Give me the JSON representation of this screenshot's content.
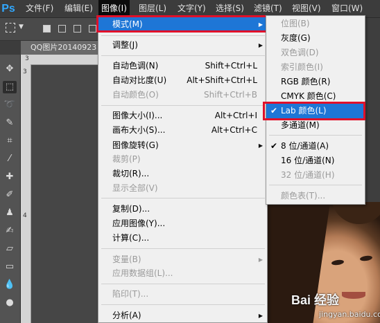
{
  "app": {
    "logo": "Ps"
  },
  "menubar": {
    "items": [
      {
        "label": "文件(F)"
      },
      {
        "label": "编辑(E)"
      },
      {
        "label": "图像(I)"
      },
      {
        "label": "图层(L)"
      },
      {
        "label": "文字(Y)"
      },
      {
        "label": "选择(S)"
      },
      {
        "label": "滤镜(T)"
      },
      {
        "label": "视图(V)"
      },
      {
        "label": "窗口(W)"
      }
    ]
  },
  "document": {
    "tab_title": "QQ图片20140923"
  },
  "rulers": {
    "top_first": "3",
    "left": [
      "3",
      "4"
    ]
  },
  "image_menu": {
    "items": [
      {
        "label": "模式(M)",
        "shortcut": "",
        "submenu": true,
        "disabled": false,
        "highlighted": true
      },
      {
        "label": "调整(J)",
        "shortcut": "",
        "submenu": true,
        "disabled": false
      },
      {
        "label": "自动色调(N)",
        "shortcut": "Shift+Ctrl+L",
        "disabled": false
      },
      {
        "label": "自动对比度(U)",
        "shortcut": "Alt+Shift+Ctrl+L",
        "disabled": false
      },
      {
        "label": "自动颜色(O)",
        "shortcut": "Shift+Ctrl+B",
        "disabled": true
      },
      {
        "label": "图像大小(I)...",
        "shortcut": "Alt+Ctrl+I",
        "disabled": false
      },
      {
        "label": "画布大小(S)...",
        "shortcut": "Alt+Ctrl+C",
        "disabled": false
      },
      {
        "label": "图像旋转(G)",
        "shortcut": "",
        "submenu": true,
        "disabled": false
      },
      {
        "label": "裁剪(P)",
        "shortcut": "",
        "disabled": true
      },
      {
        "label": "裁切(R)...",
        "shortcut": "",
        "disabled": false
      },
      {
        "label": "显示全部(V)",
        "shortcut": "",
        "disabled": true
      },
      {
        "label": "复制(D)...",
        "shortcut": "",
        "disabled": false
      },
      {
        "label": "应用图像(Y)...",
        "shortcut": "",
        "disabled": false
      },
      {
        "label": "计算(C)...",
        "shortcut": "",
        "disabled": false
      },
      {
        "label": "变量(B)",
        "shortcut": "",
        "submenu": true,
        "disabled": true
      },
      {
        "label": "应用数据组(L)...",
        "shortcut": "",
        "disabled": true
      },
      {
        "label": "陷印(T)...",
        "shortcut": "",
        "disabled": true
      },
      {
        "label": "分析(A)",
        "shortcut": "",
        "submenu": true,
        "disabled": false
      }
    ]
  },
  "mode_menu": {
    "items": [
      {
        "label": "位图(B)",
        "disabled": true
      },
      {
        "label": "灰度(G)",
        "disabled": false
      },
      {
        "label": "双色调(D)",
        "disabled": true
      },
      {
        "label": "索引颜色(I)",
        "disabled": true
      },
      {
        "label": "RGB 颜色(R)",
        "disabled": false
      },
      {
        "label": "CMYK 颜色(C)",
        "disabled": false
      },
      {
        "label": "Lab 颜色(L)",
        "disabled": false,
        "checked": true,
        "highlighted": true
      },
      {
        "label": "多通道(M)",
        "disabled": false
      },
      {
        "label": "8 位/通道(A)",
        "disabled": false,
        "checked": true
      },
      {
        "label": "16 位/通道(N)",
        "disabled": false
      },
      {
        "label": "32 位/通道(H)",
        "disabled": true
      },
      {
        "label": "颜色表(T)...",
        "disabled": true
      }
    ],
    "check_glyph": "✔"
  },
  "watermark": {
    "brand": "Bai 经验",
    "url": "jingyan.baidu.com"
  },
  "colors": {
    "highlight": "#1e76d6",
    "annotation_frame": "#e0102a",
    "menubar_bg": "#3c3c3c"
  }
}
